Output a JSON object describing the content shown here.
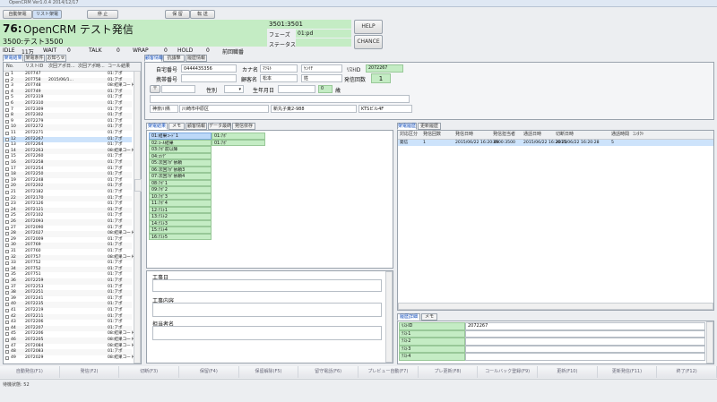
{
  "window": {
    "title": "OpenCRM Ver1.0.4 2014/12/17"
  },
  "toolbar": {
    "auto_dial": "自動架電",
    "list_dial": "リスト架電",
    "stop": "停 止",
    "hold": "保 留",
    "transfer": "転 送",
    "campaign_id_title": "76:",
    "campaign_title": "OpenCRM テスト発信",
    "sub_title": "3500:テスト3500",
    "id_box": "3501:3501",
    "phase_label": "フェーズ",
    "phase_value": "01:pd",
    "status_label": "ステータス",
    "status_value": "",
    "help": "HELP",
    "chance": "CHANCE"
  },
  "stats": [
    {
      "label": "IDLE",
      "value": "11万"
    },
    {
      "label": "WAIT",
      "value": "0"
    },
    {
      "label": "TALK",
      "value": "0"
    },
    {
      "label": "WRAP",
      "value": "0"
    },
    {
      "label": "HOLD",
      "value": "0"
    },
    {
      "label": "",
      "value": "前回職番"
    }
  ],
  "left_tabs": [
    "架電結果",
    "架電条件",
    "お知らせ"
  ],
  "left_table": {
    "headers": [
      "No.",
      "リストID",
      "次回アポ日...",
      "次回アポ時...",
      "コール結果"
    ],
    "rows": [
      {
        "no": "1",
        "id": "207747",
        "date": "",
        "result": "01:アポ"
      },
      {
        "no": "2",
        "id": "207758",
        "date": "2015/06/1...",
        "result": "01:アポ"
      },
      {
        "no": "3",
        "id": "207748",
        "date": "",
        "result": "08:結果コード10"
      },
      {
        "no": "4",
        "id": "207749",
        "date": "",
        "result": "01:アポ"
      },
      {
        "no": "5",
        "id": "2072319",
        "date": "",
        "result": "01:アポ"
      },
      {
        "no": "6",
        "id": "2072310",
        "date": "",
        "result": "01:アポ"
      },
      {
        "no": "7",
        "id": "2072309",
        "date": "",
        "result": "01:アポ"
      },
      {
        "no": "8",
        "id": "2072302",
        "date": "",
        "result": "01:アポ"
      },
      {
        "no": "9",
        "id": "2072279",
        "date": "",
        "result": "01:アポ"
      },
      {
        "no": "10",
        "id": "2072272",
        "date": "",
        "result": "01:アポ"
      },
      {
        "no": "11",
        "id": "2072271",
        "date": "",
        "result": "01:アポ"
      },
      {
        "no": "12",
        "id": "2072267",
        "date": "",
        "result": "01:アポ"
      },
      {
        "no": "13",
        "id": "2072264",
        "date": "",
        "result": "01:アポ"
      },
      {
        "no": "14",
        "id": "2072263",
        "date": "",
        "result": "08:結果コード10"
      },
      {
        "no": "15",
        "id": "2072260",
        "date": "",
        "result": "01:アポ"
      },
      {
        "no": "16",
        "id": "2072258",
        "date": "",
        "result": "01:アポ"
      },
      {
        "no": "17",
        "id": "2072254",
        "date": "",
        "result": "01:アポ"
      },
      {
        "no": "18",
        "id": "2072250",
        "date": "",
        "result": "01:アポ"
      },
      {
        "no": "19",
        "id": "2072248",
        "date": "",
        "result": "01:アポ"
      },
      {
        "no": "20",
        "id": "2072202",
        "date": "",
        "result": "01:アポ"
      },
      {
        "no": "21",
        "id": "2072182",
        "date": "",
        "result": "01:アポ"
      },
      {
        "no": "22",
        "id": "2072170",
        "date": "",
        "result": "01:アポ"
      },
      {
        "no": "23",
        "id": "2072126",
        "date": "",
        "result": "01:アポ"
      },
      {
        "no": "24",
        "id": "2072121",
        "date": "",
        "result": "01:アポ"
      },
      {
        "no": "25",
        "id": "2072102",
        "date": "",
        "result": "01:アポ"
      },
      {
        "no": "26",
        "id": "2072093",
        "date": "",
        "result": "01:アポ"
      },
      {
        "no": "27",
        "id": "2072090",
        "date": "",
        "result": "01:アポ"
      },
      {
        "no": "28",
        "id": "2072027",
        "date": "",
        "result": "08:結果コード10"
      },
      {
        "no": "29",
        "id": "2072009",
        "date": "",
        "result": "01:アポ"
      },
      {
        "no": "30",
        "id": "207769",
        "date": "",
        "result": "01:アポ"
      },
      {
        "no": "31",
        "id": "207760",
        "date": "",
        "result": "01:アポ"
      },
      {
        "no": "32",
        "id": "207757",
        "date": "",
        "result": "08:結果コード10"
      },
      {
        "no": "33",
        "id": "207752",
        "date": "",
        "result": "01:アポ"
      },
      {
        "no": "34",
        "id": "207752",
        "date": "",
        "result": "01:アポ"
      },
      {
        "no": "35",
        "id": "207751",
        "date": "",
        "result": "01:アポ"
      },
      {
        "no": "36",
        "id": "2072259",
        "date": "",
        "result": "01:アポ"
      },
      {
        "no": "37",
        "id": "2072253",
        "date": "",
        "result": "01:アポ"
      },
      {
        "no": "38",
        "id": "2072251",
        "date": "",
        "result": "01:アポ"
      },
      {
        "no": "39",
        "id": "2072241",
        "date": "",
        "result": "01:アポ"
      },
      {
        "no": "40",
        "id": "2072235",
        "date": "",
        "result": "01:アポ"
      },
      {
        "no": "41",
        "id": "2072219",
        "date": "",
        "result": "01:アポ"
      },
      {
        "no": "42",
        "id": "2072211",
        "date": "",
        "result": "01:アポ"
      },
      {
        "no": "43",
        "id": "2072206",
        "date": "",
        "result": "01:アポ"
      },
      {
        "no": "44",
        "id": "2072207",
        "date": "",
        "result": "01:アポ"
      },
      {
        "no": "45",
        "id": "2072206",
        "date": "",
        "result": "08:結果コード10"
      },
      {
        "no": "46",
        "id": "2072205",
        "date": "",
        "result": "08:結果コード10"
      },
      {
        "no": "47",
        "id": "2072084",
        "date": "",
        "result": "08:結果コード10"
      },
      {
        "no": "48",
        "id": "2072083",
        "date": "",
        "result": "01:アポ"
      },
      {
        "no": "49",
        "id": "2072029",
        "date": "",
        "result": "08:結果コード10"
      }
    ]
  },
  "customer_tabs": [
    "顧客情報",
    "抗議撃",
    "履歴情報"
  ],
  "customer": {
    "phone_label": "自宅番号",
    "phone_value": "0444435356",
    "kana_label": "カナ名",
    "kana_sei": "ﾏﾂﾓﾄ",
    "kana_mei": "ｹﾝｲﾁ",
    "list_id_label": "ﾘｽﾄID",
    "list_id_value": "2072267",
    "mobile_label": "携帯番号",
    "name_label": "顧客名",
    "name_sei": "松本",
    "name_mei": "姓",
    "call_count_label": "発信回数",
    "call_count_value": "1",
    "postal_btn": "〒",
    "gender_label": "性別",
    "birthday_label": "生年月日",
    "age_value": "0",
    "age_unit": "歳",
    "address": "神奈川県",
    "address2": "川崎市中原区",
    "address3": "新丸子東2-988",
    "address4": "KTSビル4F"
  },
  "result_tabs": [
    "架電結果",
    "メモ",
    "顧客情報",
    "データ最終",
    "発信依存"
  ],
  "result_codes": [
    "01:結果ｺｰﾄﾞ1",
    "02:ｺｰﾙ結果",
    "03:ｱﾎﾟ前以降",
    "04:ｺｿﾃﾞ",
    "05:次回ｱﾎﾟ依頼",
    "06:次回ｱﾎﾟ依頼3",
    "07:次回ｱﾎﾟ依頼4",
    "08:ｱﾎﾟ1",
    "09:ｱﾎﾟ2",
    "10:ｱﾎﾟ3",
    "11:ｱﾎﾟ4",
    "12:ﾃｽﾄ1",
    "13:ﾃｽﾄ2",
    "14:ﾃｽﾄ3",
    "15:ﾃｽﾄ4",
    "16:ﾃｽﾄ5"
  ],
  "result_detail": [
    "01:ｱﾎﾟ",
    "01:ｱﾎﾟ"
  ],
  "memo": {
    "date_label": "工事日",
    "content_label": "工事内容",
    "owner_label": "担当者名"
  },
  "history_tabs": [
    "架電履歴",
    "更新履歴"
  ],
  "history_table": {
    "headers": [
      "対応区分",
      "発信回数",
      "発信日時",
      "発信担当者",
      "通話日時",
      "切断日時",
      "通話時間",
      "ｺﾝﾀｸﾄ"
    ],
    "rows": [
      [
        "発信",
        "1",
        "2015/06/22 16:20:09",
        "3500:3500",
        "2015/06/22 16:20:25",
        "2015/06/22 16:20:28",
        "5",
        ""
      ]
    ]
  },
  "detail_tabs": [
    "履歴詳細",
    "メモ"
  ],
  "detail_table": {
    "rows": [
      [
        "ﾘｽﾄID",
        "2072267"
      ],
      [
        "ﾃｽﾄ1",
        ""
      ],
      [
        "ﾃｽﾄ2",
        ""
      ],
      [
        "ﾃｽﾄ3",
        ""
      ],
      [
        "ﾃｽﾄ4",
        ""
      ]
    ]
  },
  "footer_buttons": [
    "自動発信(F1)",
    "発信(F2)",
    "切断(F3)",
    "保留(F4)",
    "保留解除(F5)",
    "留守電話(F6)",
    "プレビュー自動(F7)",
    "プレ更新(F8)",
    "コールバック登録(F9)",
    "更新(F10)",
    "更新発信(F11)",
    "終了(F12)"
  ],
  "statusbar": {
    "text": "待機状態: 52"
  }
}
